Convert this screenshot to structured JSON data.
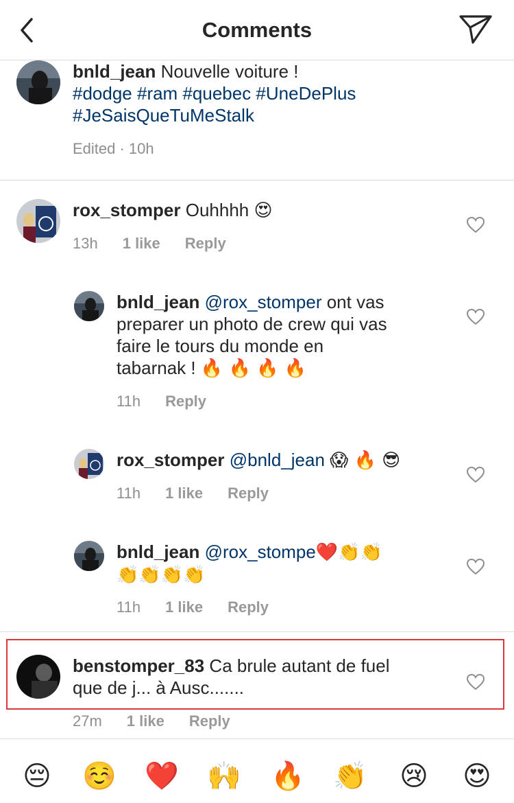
{
  "header": {
    "title": "Comments"
  },
  "caption": {
    "username": "bnld_jean",
    "text": "Nouvelle voiture !",
    "hashtags_line1": "#dodge #ram #quebec #UneDePlus",
    "hashtags_line2": "#JeSaisQueTuMeStalk",
    "meta": "Edited · 10h"
  },
  "comments": [
    {
      "username": "rox_stomper",
      "text": "Ouhhhh",
      "emoji": "😍",
      "time": "13h",
      "likes": "1 like",
      "reply": "Reply"
    },
    {
      "username": "bnld_jean",
      "mention": "@rox_stomper",
      "text_line1": " ont vas",
      "text_line2": "preparer un photo de crew qui vas",
      "text_line3": "faire le tours du monde en",
      "text_line4": "tabarnak !",
      "emoji": "🔥 🔥 🔥 🔥",
      "time": "11h",
      "reply": "Reply"
    },
    {
      "username": "rox_stomper",
      "mention": "@bnld_jean",
      "emoji": "😱 🔥 😎",
      "time": "11h",
      "likes": "1 like",
      "reply": "Reply"
    },
    {
      "username": "bnld_jean",
      "mention": "@rox_stompe",
      "emoji_line1": "❤️👏👏",
      "emoji_line2": "👏👏👏👏",
      "time": "11h",
      "likes": "1 like",
      "reply": "Reply"
    },
    {
      "username": "benstomper_83",
      "text_line1": "Ca brule autant de fuel",
      "text_line2": "que de j... à Ausc.......",
      "time": "27m",
      "likes": "1 like",
      "reply": "Reply"
    }
  ],
  "emoji_bar": [
    "😔",
    "☺️",
    "❤️",
    "🙌",
    "🔥",
    "👏",
    "😢",
    "😍"
  ],
  "colors": {
    "hashtag": "#003569",
    "meta": "#8e8e8e",
    "highlight": "#d63a3a"
  }
}
